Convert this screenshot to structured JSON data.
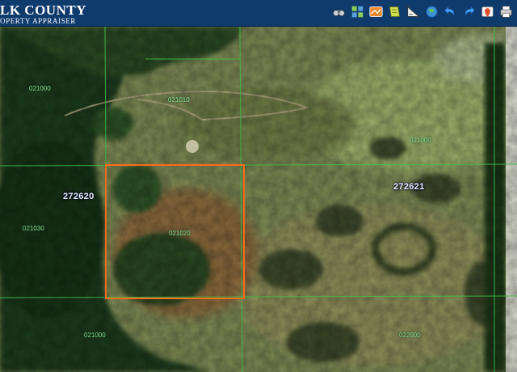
{
  "header": {
    "title": "LK COUNTY",
    "subtitle": "OPERTY APPRAISER"
  },
  "toolbar": [
    {
      "name": "binoculars-icon",
      "color": "#d9d9d9"
    },
    {
      "name": "grid-icon",
      "color": "#7dbb4a"
    },
    {
      "name": "orange-map-icon",
      "color": "#f08a2c"
    },
    {
      "name": "layers-icon",
      "color": "#c8d84a"
    },
    {
      "name": "measure-icon",
      "color": "#e8e8e8"
    },
    {
      "name": "globe-icon",
      "color": "#3a8fd8"
    },
    {
      "name": "undo-icon",
      "color": "#4aa0ff"
    },
    {
      "name": "redo-icon",
      "color": "#4aa0ff"
    },
    {
      "name": "map-pin-icon",
      "color": "#e94a2c"
    },
    {
      "name": "print-icon",
      "color": "#e0e0e0"
    }
  ],
  "map": {
    "section_labels": [
      "272620",
      "272621"
    ],
    "parcel_labels": [
      "021010",
      "021020",
      "021030",
      "021000",
      "022000",
      "021000",
      "021000"
    ],
    "selection_color": "#ff6a1a",
    "parcel_line_color": "#3fbf4a"
  }
}
